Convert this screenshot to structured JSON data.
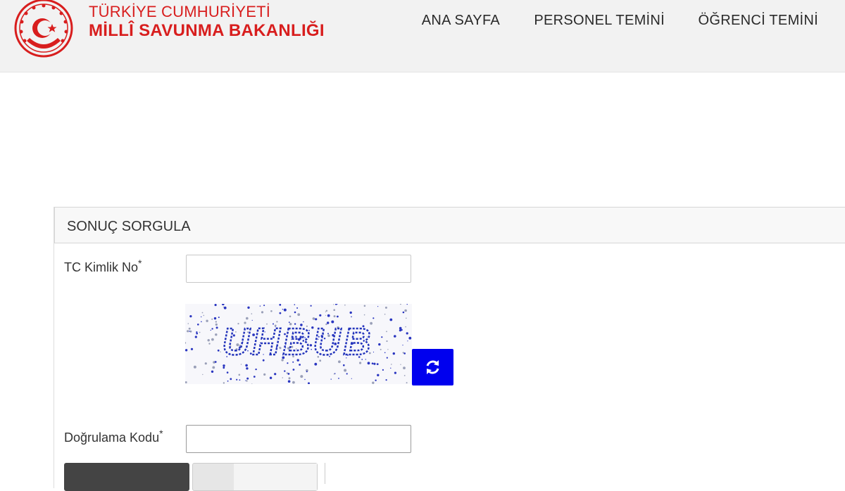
{
  "header": {
    "org_line1": "TÜRKİYE CUMHURİYETİ",
    "org_line2": "MİLLÎ SAVUNMA BAKANLIĞI",
    "brand_color": "#d81e1e"
  },
  "nav": {
    "items": [
      {
        "label": "ANA SAYFA"
      },
      {
        "label": "PERSONEL TEMİNİ"
      },
      {
        "label": "ÖĞRENCİ TEMİNİ"
      }
    ]
  },
  "panel": {
    "title": "SONUÇ SORGULA"
  },
  "form": {
    "tc_label": "TC Kimlik No",
    "tc_value": "",
    "required_marker": "*",
    "captcha_text": "UHBUB",
    "captcha_color": "#2233bb",
    "refresh_icon": "refresh-icon",
    "refresh_color": "#0000ee",
    "code_label": "Doğrulama Kodu",
    "code_value": ""
  }
}
